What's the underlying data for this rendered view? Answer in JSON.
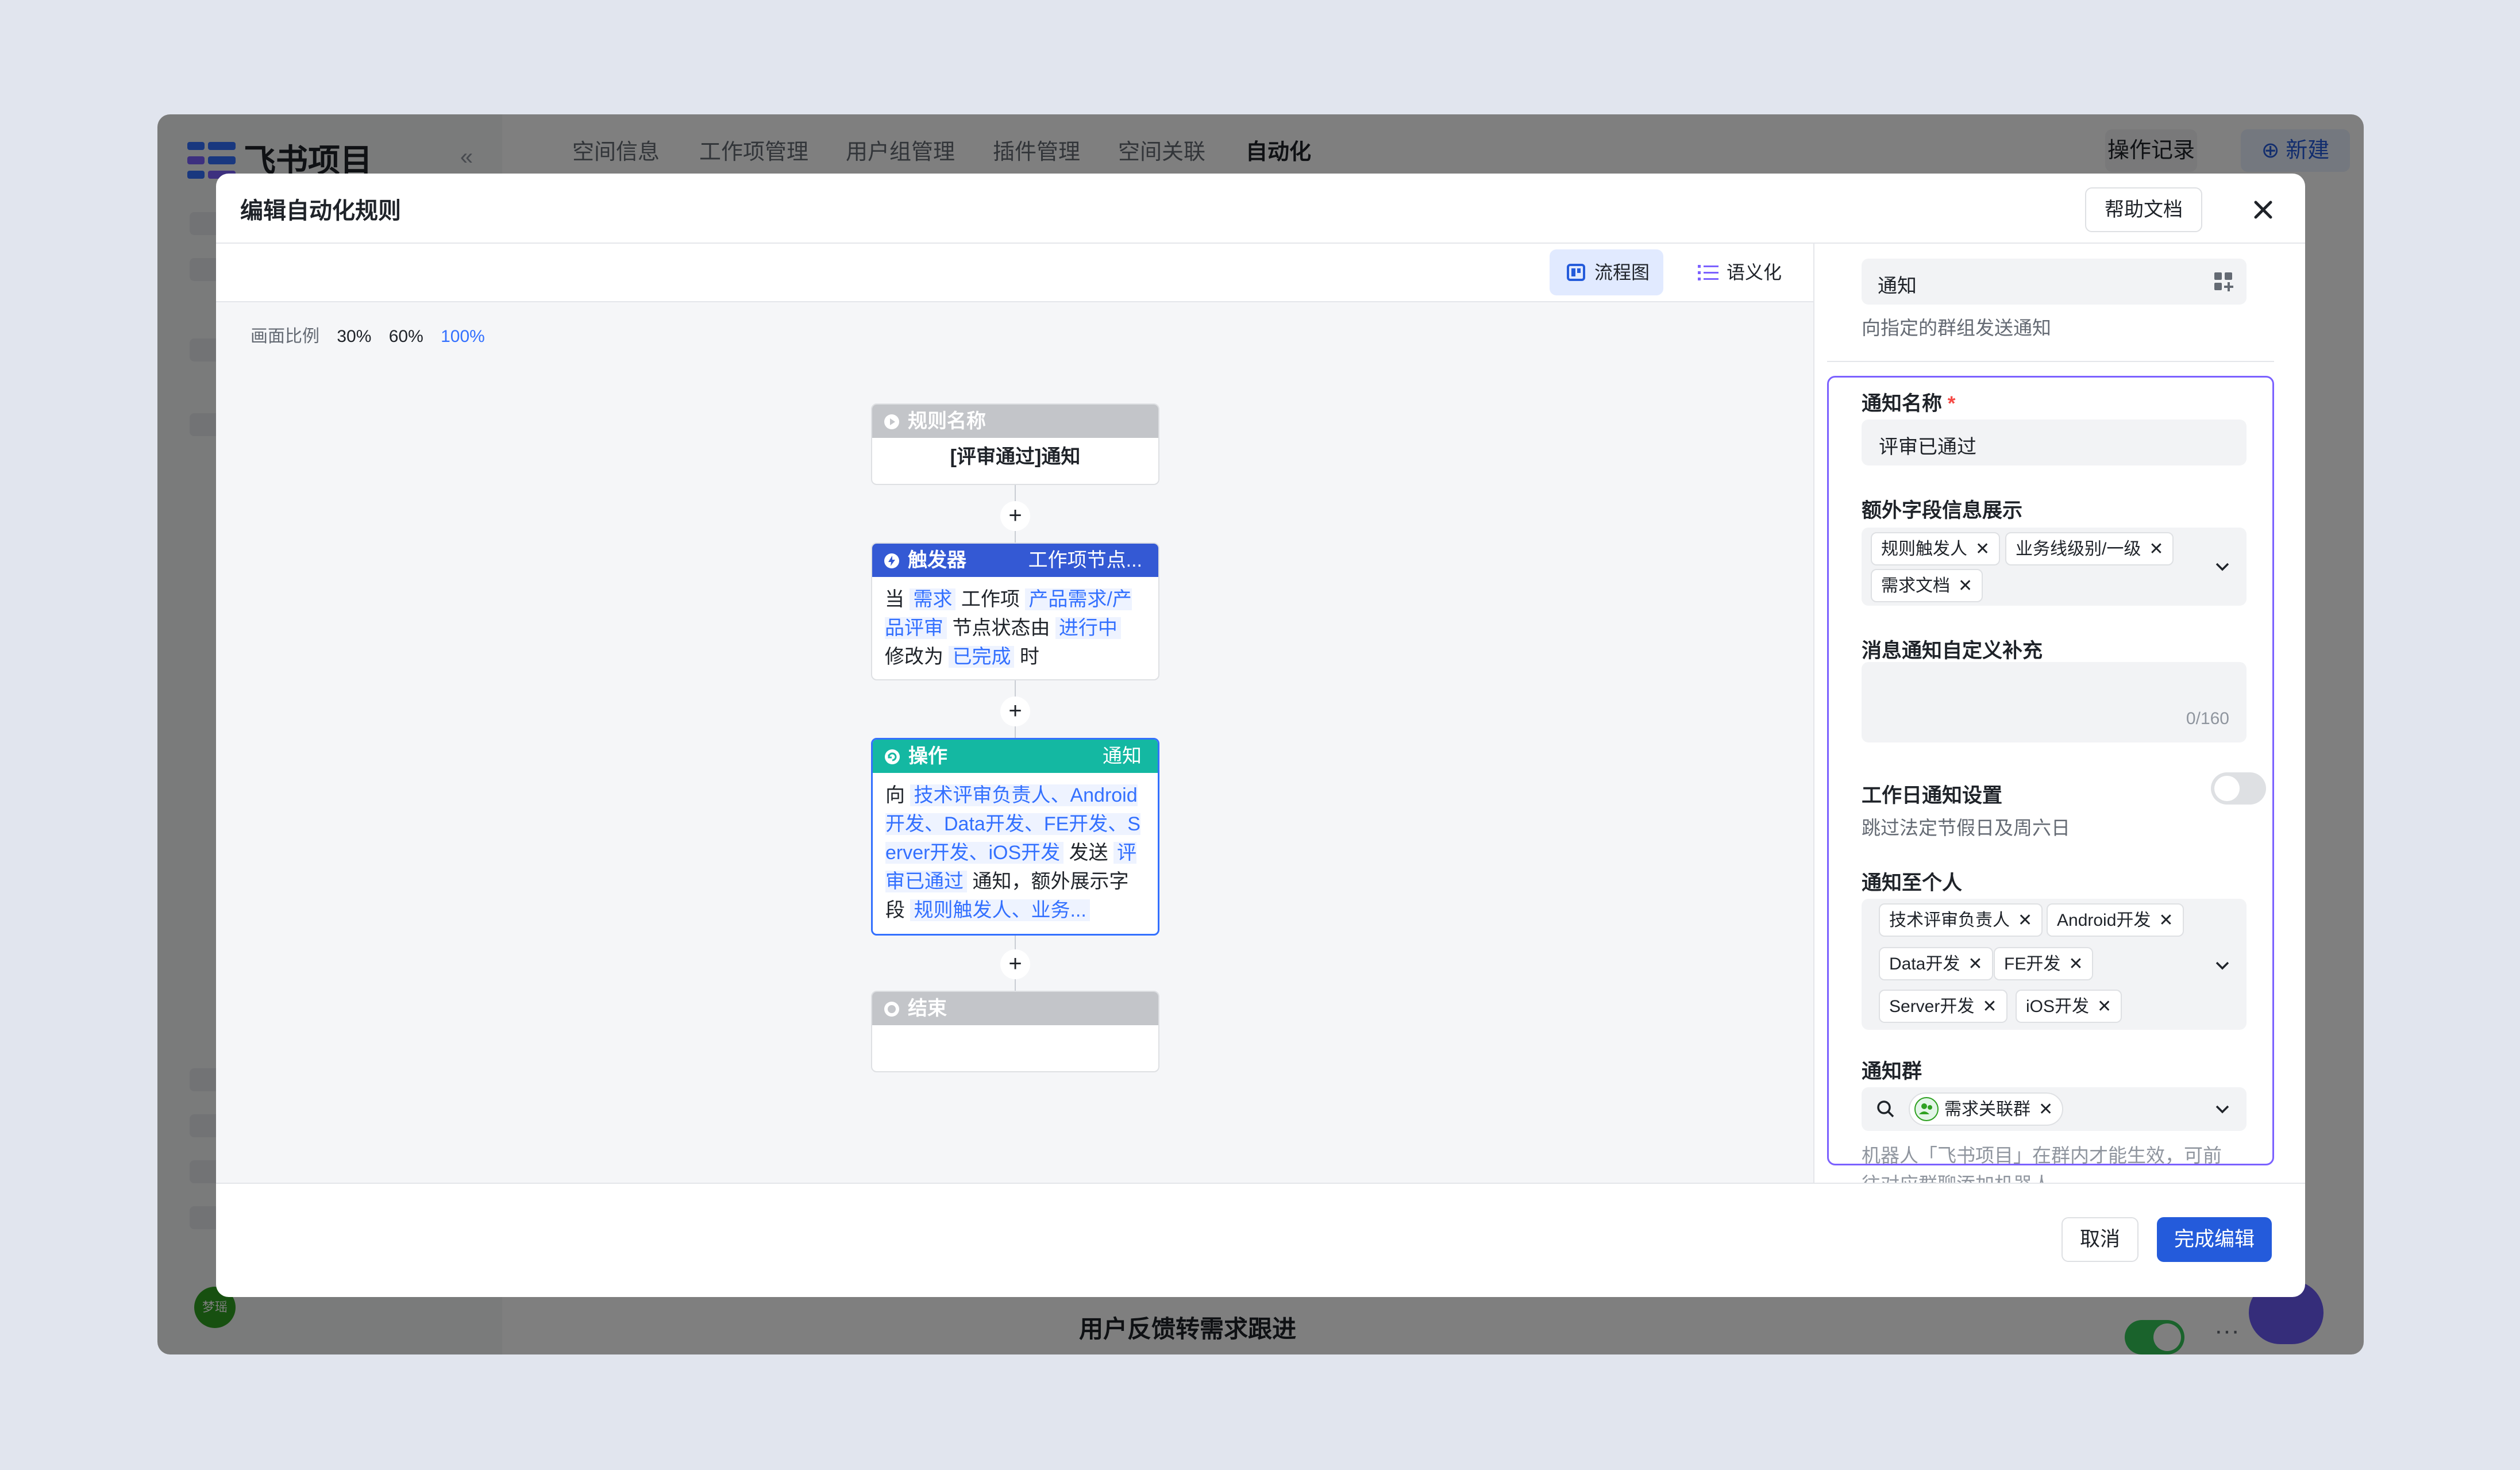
{
  "app": {
    "logo_text": "飞书项目",
    "collapse_icon": "«",
    "tabs": [
      "空间信息",
      "工作项管理",
      "用户组管理",
      "插件管理",
      "空间关联",
      "自动化"
    ],
    "active_tab": "自动化",
    "log_button": "操作记录",
    "new_button": "新建",
    "bottom_rule_title": "用户反馈转需求跟进",
    "avatar_text": "梦瑶"
  },
  "modal": {
    "title": "编辑自动化规则",
    "help_button": "帮助文档",
    "view_flow": "流程图",
    "view_semantic": "语义化",
    "zoom": {
      "label": "画面比例",
      "options": [
        "30%",
        "60%",
        "100%"
      ],
      "active": "100%"
    },
    "nodes": {
      "rule_name": {
        "header": "规则名称",
        "value": "[评审通过]通知"
      },
      "trigger": {
        "header": "触发器",
        "right": "工作项节点...",
        "t1": "当",
        "h1": "需求",
        "t2": "工作项",
        "h2": "产品需求/产品评审",
        "t3": "节点状态由",
        "h3": "进行中",
        "t4": "修改为",
        "h4": "已完成",
        "t5": "时"
      },
      "action": {
        "header": "操作",
        "right": "通知",
        "t1": "向",
        "h1": "技术评审负责人、Android开发、Data开发、FE开发、Server开发、iOS开发",
        "t2": "发送",
        "h2": "评审已通过",
        "t3": "通知，额外展示字段",
        "h3": "规则触发人、业务..."
      },
      "end": {
        "header": "结束"
      }
    },
    "panel": {
      "action_type_value": "通知",
      "action_type_hint": "向指定的群组发送通知",
      "notify_name_label": "通知名称",
      "required_mark": "*",
      "notify_name_value": "评审已通过",
      "extra_fields_label": "额外字段信息展示",
      "extra_fields": [
        "规则触发人",
        "业务线级别/一级",
        "需求文档"
      ],
      "custom_label": "消息通知自定义补充",
      "custom_count": "0/160",
      "workday_label": "工作日通知设置",
      "workday_hint": "跳过法定节假日及周六日",
      "workday_enabled": false,
      "personal_label": "通知至个人",
      "personal_tags": [
        "技术评审负责人",
        "Android开发",
        "Data开发",
        "FE开发",
        "Server开发",
        "iOS开发"
      ],
      "group_label": "通知群",
      "group_tags": [
        "需求关联群"
      ],
      "group_hint_line1": "机器人「飞书项目」在群内才能生效，可前",
      "group_hint_line2": "往对应群聊添加机器人"
    },
    "cancel_button": "取消",
    "done_button": "完成编辑"
  },
  "colors": {
    "trigger_header": "#3459d4",
    "action_header": "#14b8a2",
    "node_gray_header": "#c3c5c9",
    "primary": "#245bdb",
    "highlight_border": "#7b61ff"
  }
}
